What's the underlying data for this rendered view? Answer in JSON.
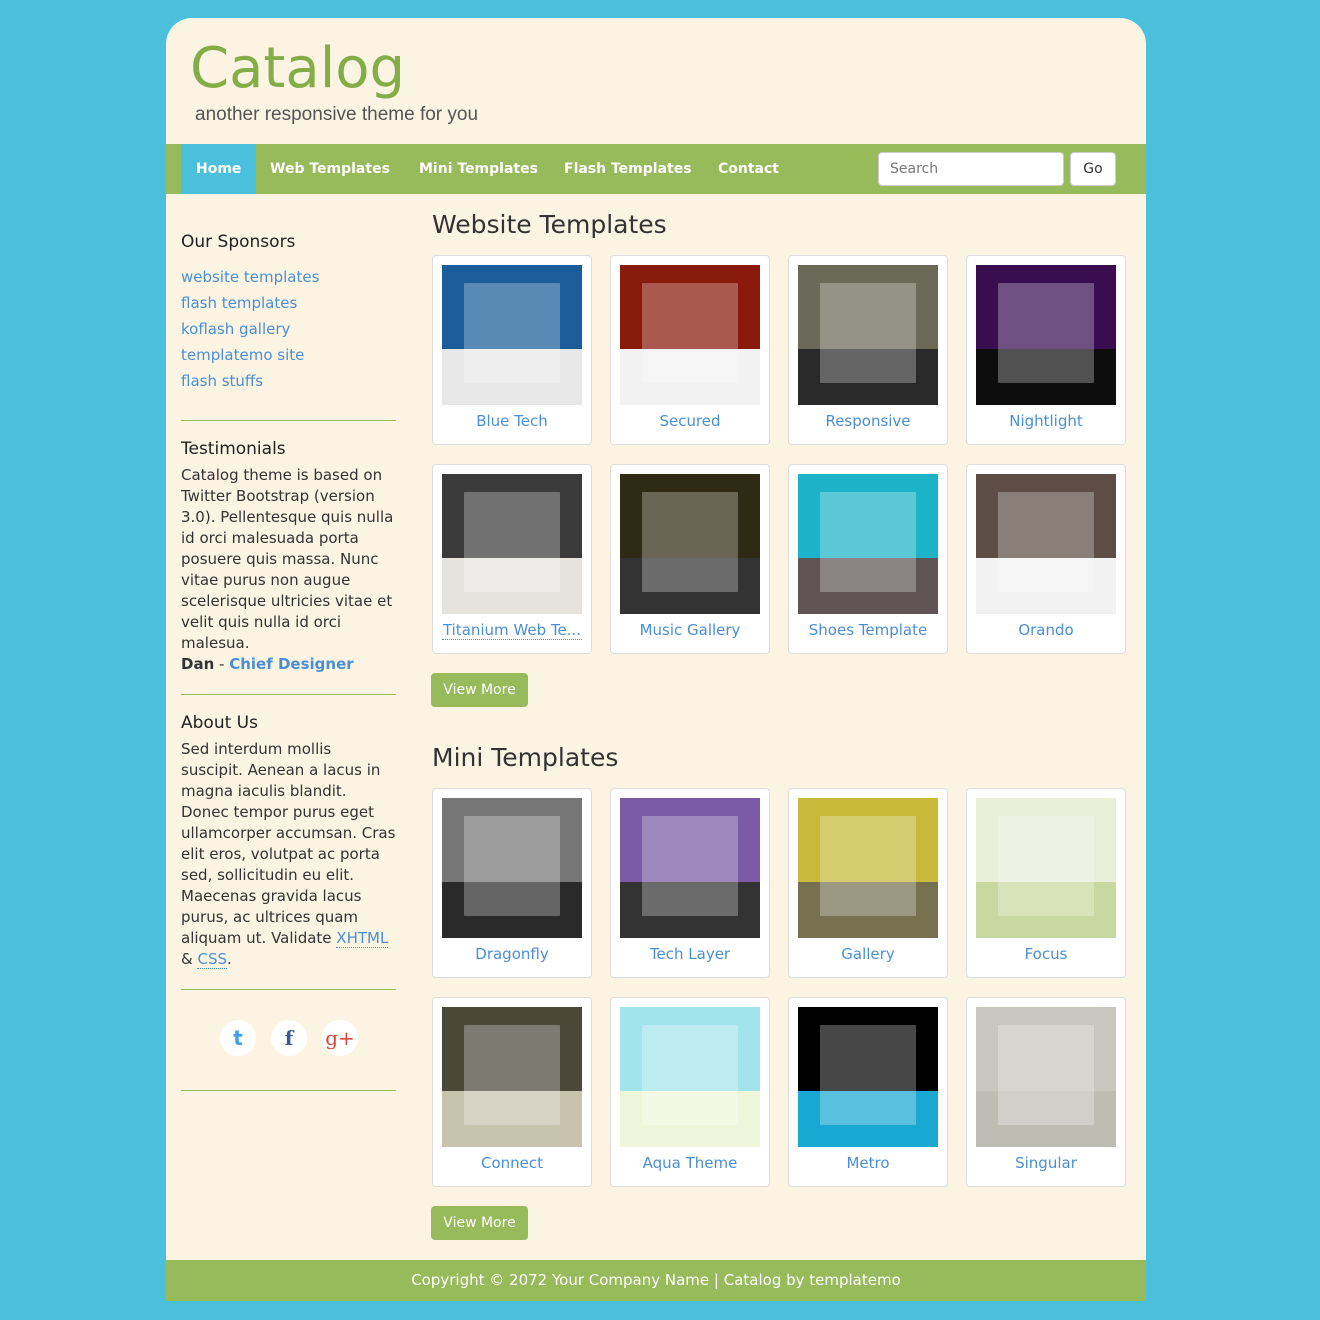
{
  "header": {
    "logo": "Catalog",
    "tagline": "another responsive theme for you"
  },
  "nav": {
    "items": [
      {
        "label": "Home",
        "active": true
      },
      {
        "label": "Web Templates"
      },
      {
        "label": "Mini Templates"
      },
      {
        "label": "Flash Templates"
      },
      {
        "label": "Contact"
      }
    ],
    "search_placeholder": "Search",
    "go_label": "Go"
  },
  "sidebar": {
    "sponsors": {
      "title": "Our Sponsors",
      "links": [
        "website templates",
        "flash templates",
        "koflash gallery",
        "templatemo site",
        "flash stuffs"
      ]
    },
    "testimonials": {
      "title": "Testimonials",
      "text": "Catalog theme is based on Twitter Bootstrap (version 3.0). Pellentesque quis nulla id orci malesuada porta posuere quis massa. Nunc vitae purus non augue scelerisque ultricies vitae et velit quis nulla id orci malesua.",
      "author": "Dan",
      "separator": " - ",
      "role": "Chief Designer"
    },
    "about": {
      "title": "About Us",
      "text": "Sed interdum mollis suscipit. Aenean a lacus in magna iaculis blandit. Donec tempor purus eget ullamcorper accumsan. Cras elit eros, volutpat ac porta sed, sollicitudin eu elit. Maecenas gravida lacus purus, ac ultrices quam aliquam ut.",
      "validate_prefix": "Validate ",
      "xhtml": "XHTML",
      "amp": " & ",
      "css": "CSS",
      "end": "."
    },
    "social": [
      {
        "name": "twitter",
        "glyph": "t",
        "color": "#3fa0f0"
      },
      {
        "name": "facebook",
        "glyph": "f",
        "color": "#3b5998"
      },
      {
        "name": "google-plus",
        "glyph": "g+",
        "color": "#d34836"
      }
    ]
  },
  "website_templates": {
    "title": "Website Templates",
    "items": [
      {
        "label": "Blue Tech",
        "colors": [
          "#1a5d9a",
          "#e8e8e8"
        ]
      },
      {
        "label": "Secured",
        "colors": [
          "#8a1a0c",
          "#f2f2f2"
        ]
      },
      {
        "label": "Responsive",
        "colors": [
          "#6b6a58",
          "#2a2a2a"
        ]
      },
      {
        "label": "Nightlight",
        "colors": [
          "#3a0d50",
          "#0d0d0d"
        ]
      },
      {
        "label": "Titanium Web Te...",
        "colors": [
          "#3b3b3b",
          "#e6e3df"
        ]
      },
      {
        "label": "Music Gallery",
        "colors": [
          "#2e2a14",
          "#333"
        ]
      },
      {
        "label": "Shoes Template",
        "colors": [
          "#1cb3c8",
          "#5f5556"
        ]
      },
      {
        "label": "Orando",
        "colors": [
          "#5e4d45",
          "#f2f2f2"
        ]
      }
    ],
    "view_more": "View More"
  },
  "mini_templates": {
    "title": "Mini Templates",
    "items": [
      {
        "label": "Dragonfly",
        "colors": [
          "#777",
          "#2a2a2a"
        ]
      },
      {
        "label": "Tech Layer",
        "colors": [
          "#7b5aa6",
          "#333"
        ]
      },
      {
        "label": "Gallery",
        "colors": [
          "#c9b93a",
          "#77714f"
        ]
      },
      {
        "label": "Focus",
        "colors": [
          "#e8eed8",
          "#c9d8a0"
        ]
      },
      {
        "label": "Connect",
        "colors": [
          "#4b4838",
          "#c8c3ad"
        ]
      },
      {
        "label": "Aqua Theme",
        "colors": [
          "#a2e4ec",
          "#eef5d8"
        ]
      },
      {
        "label": "Metro",
        "colors": [
          "#000",
          "#19a8d1"
        ]
      },
      {
        "label": "Singular",
        "colors": [
          "#c8c7bf",
          "#bebdb4"
        ]
      }
    ],
    "view_more": "View More"
  },
  "footer": {
    "text": "Copyright © 2072 Your Company Name | Catalog by templatemo"
  },
  "colors": {
    "accent_green": "#97ba5a",
    "logo_green": "#84ad48",
    "sky_blue": "#4bc0dc",
    "link_blue": "#4a8fd4",
    "cream": "#fcf4e3"
  }
}
